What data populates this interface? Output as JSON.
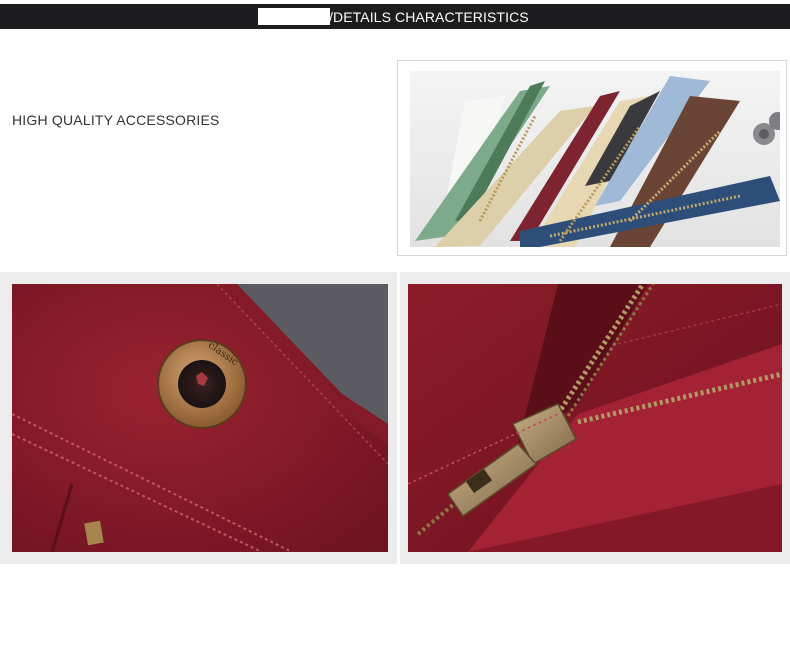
{
  "header": {
    "title": "/DETAILS CHARACTERISTICS"
  },
  "section": {
    "label": "HIGH QUALITY ACCESSORIES"
  },
  "images": {
    "zippers": "colorful zippers photo",
    "button": "button close-up photo",
    "zipper_closeup": "zipper close-up photo"
  },
  "button_text": "classic",
  "colors": {
    "header_bg": "#1d1d1f",
    "header_text": "#ffffff",
    "fabric": "#8b1a26",
    "panel_bg": "#ececed"
  }
}
